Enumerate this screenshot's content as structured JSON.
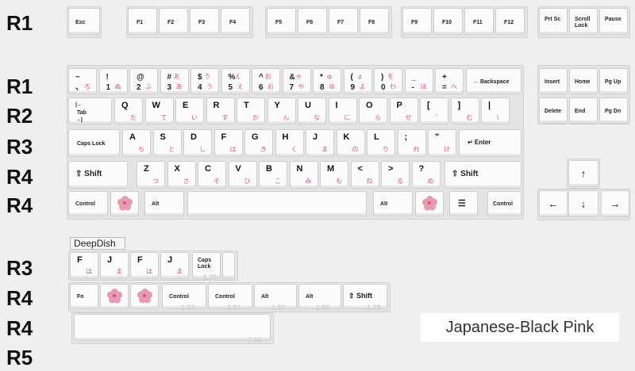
{
  "row_labels": [
    "R1",
    "R1",
    "R2",
    "R3",
    "R4",
    "R4",
    "R3",
    "R4",
    "R4",
    "R5"
  ],
  "fn_row": {
    "esc": "Esc",
    "f": [
      "F1",
      "F2",
      "F3",
      "F4",
      "F5",
      "F6",
      "F7",
      "F8",
      "F9",
      "F10",
      "F11",
      "F12"
    ],
    "nav": [
      "Prt Sc",
      "Scroll Lock",
      "Pause"
    ]
  },
  "number_row": [
    {
      "top": "~",
      "bottom": "、",
      "kana1": "",
      "kana2": "ろ"
    },
    {
      "top": "!",
      "bottom": "1",
      "kana1": "",
      "kana2": "ぬ"
    },
    {
      "top": "@",
      "bottom": "2",
      "kana1": "",
      "kana2": "ふ"
    },
    {
      "top": "#",
      "bottom": "3",
      "kana1": "あ",
      "kana2": "あ"
    },
    {
      "top": "$",
      "bottom": "4",
      "kana1": "う",
      "kana2": "う"
    },
    {
      "top": "%",
      "bottom": "5",
      "kana1": "え",
      "kana2": "え"
    },
    {
      "top": "^",
      "bottom": "6",
      "kana1": "お",
      "kana2": "お"
    },
    {
      "top": "&",
      "bottom": "7",
      "kana1": "ゃ",
      "kana2": "や"
    },
    {
      "top": "*",
      "bottom": "8",
      "kana1": "ゅ",
      "kana2": "ゆ"
    },
    {
      "top": "(",
      "bottom": "9",
      "kana1": "ょ",
      "kana2": "よ"
    },
    {
      "top": ")",
      "bottom": "0",
      "kana1": "を",
      "kana2": "わ"
    },
    {
      "top": "_",
      "bottom": "-",
      "kana1": "",
      "kana2": "ほ"
    },
    {
      "top": "+",
      "bottom": "=",
      "kana1": "",
      "kana2": "へ"
    }
  ],
  "backspace": "Backspace",
  "nav_cluster": [
    "Insert",
    "Home",
    "Pg Up",
    "Delete",
    "End",
    "Pg Dn"
  ],
  "tab": "Tab",
  "q_row": [
    {
      "l": "Q",
      "k": "た"
    },
    {
      "l": "W",
      "k": "て"
    },
    {
      "l": "E",
      "k": "い"
    },
    {
      "l": "R",
      "k": "す"
    },
    {
      "l": "T",
      "k": "か"
    },
    {
      "l": "Y",
      "k": "ん"
    },
    {
      "l": "U",
      "k": "な"
    },
    {
      "l": "I",
      "k": "に"
    },
    {
      "l": "O",
      "k": "ら"
    },
    {
      "l": "P",
      "k": "せ"
    },
    {
      "l": "[",
      "k": "゛"
    },
    {
      "l": "]",
      "k": "む"
    },
    {
      "l": "|",
      "k": "\\"
    }
  ],
  "caps": "Caps Lock",
  "a_row": [
    {
      "l": "A",
      "k": "ち"
    },
    {
      "l": "S",
      "k": "と"
    },
    {
      "l": "D",
      "k": "し"
    },
    {
      "l": "F",
      "k": "は"
    },
    {
      "l": "G",
      "k": "き"
    },
    {
      "l": "H",
      "k": "く"
    },
    {
      "l": "J",
      "k": "ま"
    },
    {
      "l": "K",
      "k": "の"
    },
    {
      "l": "L",
      "k": "り"
    },
    {
      "l": ";",
      "k": "れ"
    },
    {
      "l": "\"",
      "k": "け"
    }
  ],
  "enter": "Enter",
  "shift": "Shift",
  "z_row": [
    {
      "l": "Z",
      "k": "つ"
    },
    {
      "l": "X",
      "k": "さ"
    },
    {
      "l": "C",
      "k": "そ"
    },
    {
      "l": "V",
      "k": "ひ"
    },
    {
      "l": "B",
      "k": "こ"
    },
    {
      "l": "N",
      "k": "み"
    },
    {
      "l": "M",
      "k": "も"
    },
    {
      "l": "<",
      "k": "ね"
    },
    {
      "l": ">",
      "k": "る"
    },
    {
      "l": "?",
      "k": "め"
    }
  ],
  "bottom_row": {
    "control": "Control",
    "alt": "Alt"
  },
  "arrows": {
    "up": "↑",
    "left": "←",
    "down": "↓",
    "right": "→"
  },
  "deepdish": {
    "title": "DeepDish",
    "keys": [
      {
        "l": "F",
        "k": "は"
      },
      {
        "l": "J",
        "k": "ま"
      },
      {
        "l": "F",
        "k": "は"
      },
      {
        "l": "J",
        "k": "ま"
      }
    ],
    "caps": "Caps Lock",
    "fn": "Fn",
    "control": "Control",
    "alt": "Alt",
    "shift": "Shift",
    "sizes": [
      "1.75",
      "1.50",
      "1.50",
      "1.50",
      "1.50",
      "1.75",
      "7.00"
    ]
  },
  "caption": "Japanese-Black Pink"
}
